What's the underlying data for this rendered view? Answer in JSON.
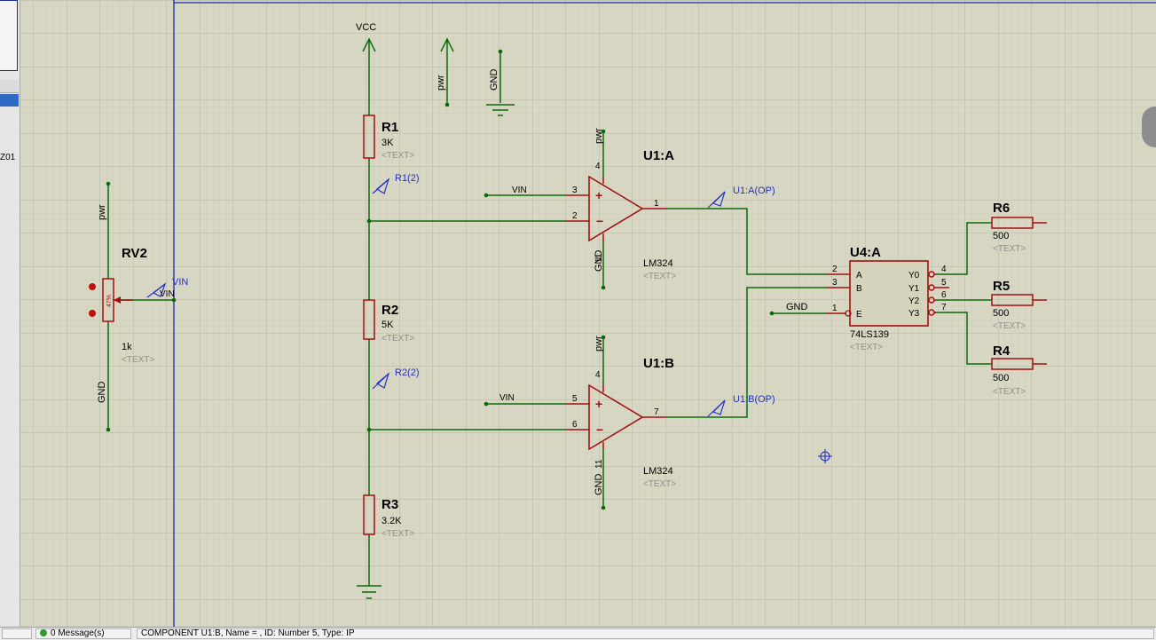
{
  "left_panel": {
    "label": "Z01"
  },
  "status_bar": {
    "messages_label": "0 Message(s)",
    "component_info": "COMPONENT U1:B, Name = , ID: Number 5, Type: IP"
  },
  "schematic": {
    "colors": {
      "wire": "#0a6b0a",
      "component": "#a31010",
      "probe": "#2431c2",
      "label": "#000000",
      "hidden": "#8e8e8e",
      "sheet_border": "#1b2ab4"
    },
    "power_symbols": {
      "vcc": "VCC",
      "pwr": "pwr",
      "gnd": "GND"
    },
    "resistors": [
      {
        "id": "r1",
        "ref": "R1",
        "value": "3K",
        "text": "<TEXT>"
      },
      {
        "id": "r2",
        "ref": "R2",
        "value": "5K",
        "text": "<TEXT>"
      },
      {
        "id": "r3",
        "ref": "R3",
        "value": "3.2K",
        "text": "<TEXT>"
      },
      {
        "id": "r6",
        "ref": "R6",
        "value": "500",
        "text": "<TEXT>"
      },
      {
        "id": "r5",
        "ref": "R5",
        "value": "500",
        "text": "<TEXT>"
      },
      {
        "id": "r4",
        "ref": "R4",
        "value": "500",
        "text": "<TEXT>"
      }
    ],
    "potentiometer": {
      "ref": "RV2",
      "value": "1k",
      "text": "<TEXT>",
      "setting": "47%",
      "top_label": "pwr",
      "bottom_label": "GND",
      "wiper_net": "VIN",
      "probe": "VIN"
    },
    "opamps": [
      {
        "id": "u1a",
        "ref": "U1:A",
        "part": "LM324",
        "text": "<TEXT>",
        "in_net": "VIN",
        "pin_plus": "3",
        "pin_minus": "2",
        "pin_out": "1",
        "pin_vcc": "4",
        "pin_gnd": "11",
        "vcc_label": "pwr",
        "gnd_label": "GND",
        "probe": "U1:A(OP)"
      },
      {
        "id": "u1b",
        "ref": "U1:B",
        "part": "LM324",
        "text": "<TEXT>",
        "in_net": "VIN",
        "pin_plus": "5",
        "pin_minus": "6",
        "pin_out": "7",
        "pin_vcc": "4",
        "pin_gnd": "11",
        "vcc_label": "pwr",
        "gnd_label": "GND",
        "probe": "U1:B(OP)"
      }
    ],
    "decoder": {
      "ref": "U4:A",
      "part": "74LS139",
      "text": "<TEXT>",
      "inputs": [
        {
          "name": "A",
          "pin": "2"
        },
        {
          "name": "B",
          "pin": "3"
        },
        {
          "name": "E",
          "pin": "1"
        }
      ],
      "outputs": [
        {
          "name": "Y0",
          "pin": "4"
        },
        {
          "name": "Y1",
          "pin": "5"
        },
        {
          "name": "Y2",
          "pin": "6"
        },
        {
          "name": "Y3",
          "pin": "7"
        }
      ],
      "enable_net": "GND"
    },
    "probes": {
      "r1": "R1(2)",
      "r2": "R2(2)"
    }
  }
}
